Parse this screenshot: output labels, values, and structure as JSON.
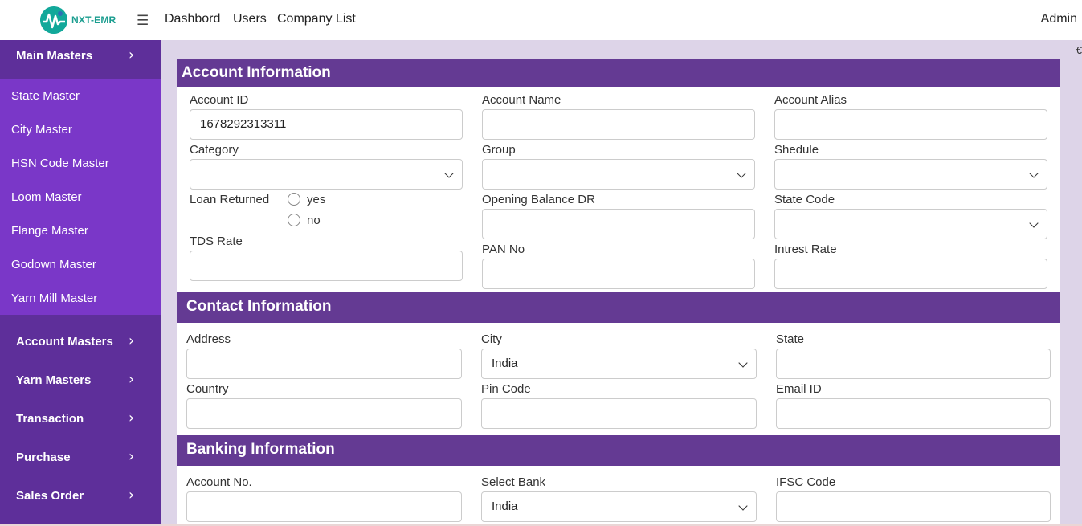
{
  "brand": {
    "logo_text": "NXT-EMR"
  },
  "topnav": {
    "links": [
      "Dashbord",
      "Users",
      "Company List"
    ],
    "user": "Admin"
  },
  "sidebar": {
    "main_masters": "Main Masters",
    "sub_items": [
      "State Master",
      "City Master",
      "HSN Code Master",
      "Loom Master",
      "Flange Master",
      "Godown Master",
      "Yarn Mill Master"
    ],
    "sections": [
      "Account Masters",
      "Yarn Masters",
      "Transaction",
      "Purchase",
      "Sales Order"
    ]
  },
  "corner_glyph": "€",
  "account_info": {
    "title": "Account Information",
    "account_id": {
      "label": "Account ID",
      "value": "1678292313311"
    },
    "account_name": {
      "label": "Account Name",
      "value": ""
    },
    "account_alias": {
      "label": "Account Alias",
      "value": ""
    },
    "category": {
      "label": "Category",
      "value": ""
    },
    "group": {
      "label": "Group",
      "value": ""
    },
    "shedule": {
      "label": "Shedule",
      "value": ""
    },
    "loan_returned": {
      "label": "Loan Returned",
      "options": [
        "yes",
        "no"
      ]
    },
    "opening_balance": {
      "label": "Opening Balance DR",
      "value": ""
    },
    "state_code": {
      "label": "State Code",
      "value": ""
    },
    "tds_rate": {
      "label": "TDS Rate",
      "value": ""
    },
    "pan_no": {
      "label": "PAN No",
      "value": ""
    },
    "intrest_rate": {
      "label": "Intrest Rate",
      "value": ""
    }
  },
  "contact_info": {
    "title": "Contact Information",
    "address": {
      "label": "Address",
      "value": ""
    },
    "city": {
      "label": "City",
      "value": "India"
    },
    "state": {
      "label": "State",
      "value": ""
    },
    "country": {
      "label": "Country",
      "value": ""
    },
    "pin_code": {
      "label": "Pin Code",
      "value": ""
    },
    "email_id": {
      "label": "Email ID",
      "value": ""
    }
  },
  "banking_info": {
    "title": "Banking Information",
    "account_no": {
      "label": "Account No.",
      "value": ""
    },
    "select_bank": {
      "label": "Select Bank",
      "value": "India"
    },
    "ifsc_code": {
      "label": "IFSC Code",
      "value": ""
    }
  },
  "colors": {
    "sidebar_dark": "#5e2f9a",
    "sidebar_light": "#7a37c8",
    "section_header": "#643a93",
    "page_bg": "#ddd4e8"
  },
  "icons": [
    "menu-icon",
    "chevron-right-icon",
    "chevron-down-icon"
  ]
}
